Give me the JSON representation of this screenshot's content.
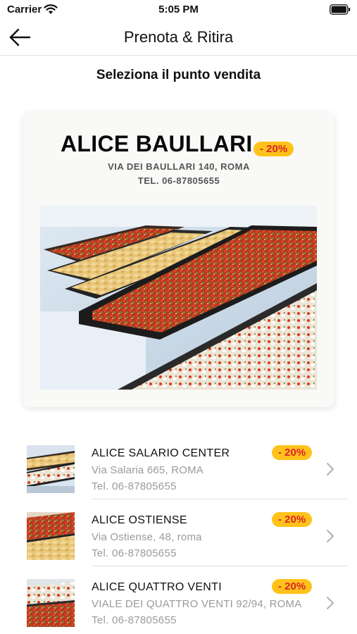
{
  "status_bar": {
    "carrier": "Carrier",
    "time": "5:05 PM"
  },
  "nav": {
    "title": "Prenota & Ritira",
    "back_icon": "arrow-left-icon"
  },
  "section_title": "Seleziona il punto vendita",
  "colors": {
    "badge_bg": "#ffc21a",
    "badge_text": "#d8242c",
    "secondary_text": "#9a9a9a"
  },
  "featured": {
    "name": "ALICE BAULLARI",
    "badge": "- 20%",
    "address": "VIA DEI BAULLARI 140, ROMA",
    "phone": "TEL. 06-87805655",
    "image": "pizza-trays-photo"
  },
  "stores": [
    {
      "name": "ALICE SALARIO CENTER",
      "address": "Via Salaria 665, ROMA",
      "phone": "Tel. 06-87805655",
      "badge": "- 20%"
    },
    {
      "name": "ALICE OSTIENSE",
      "address": "Via Ostiense, 48, roma",
      "phone": "Tel. 06-87805655",
      "badge": "- 20%"
    },
    {
      "name": "ALICE QUATTRO VENTI",
      "address": "VIALE DEI QUATTRO VENTI 92/94, ROMA",
      "phone": "Tel. 06-87805655",
      "badge": "- 20%"
    }
  ]
}
